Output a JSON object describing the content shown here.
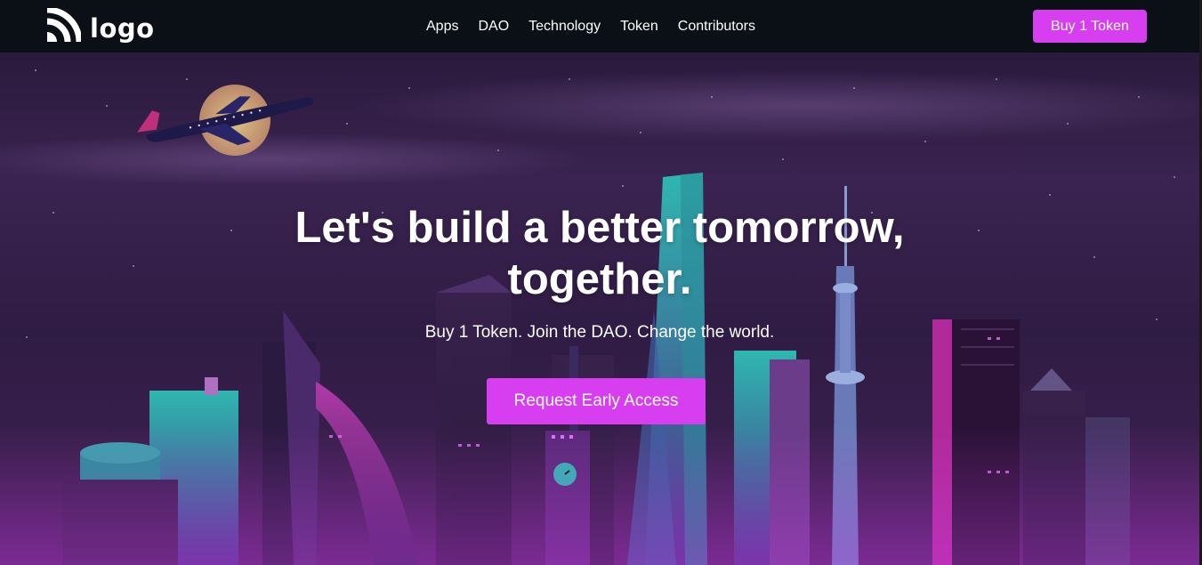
{
  "navbar": {
    "logo_text": "logo",
    "links": [
      "Apps",
      "DAO",
      "Technology",
      "Token",
      "Contributors"
    ],
    "buy_label": "Buy 1 Token"
  },
  "hero": {
    "title_line1": "Let's build a better tomorrow,",
    "title_line2": "together.",
    "subtitle": "Buy 1 Token. Join the DAO. Change the world.",
    "cta_label": "Request Early Access"
  },
  "icons": {
    "logo": "rss-feed-icon"
  },
  "colors": {
    "navbar_bg": "#0a1016",
    "accent": "#d63ef0",
    "hero_sky": "#2f1c44"
  }
}
